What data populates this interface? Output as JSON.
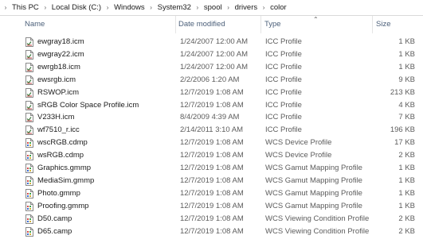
{
  "breadcrumb": [
    "This PC",
    "Local Disk (C:)",
    "Windows",
    "System32",
    "spool",
    "drivers",
    "color"
  ],
  "columns": {
    "name": "Name",
    "date": "Date modified",
    "type": "Type",
    "size": "Size"
  },
  "files": [
    {
      "name": "ewgray18.icm",
      "date": "1/24/2007 12:00 AM",
      "type": "ICC Profile",
      "size": "1 KB",
      "icon": "icc-profile-icon"
    },
    {
      "name": "ewgray22.icm",
      "date": "1/24/2007 12:00 AM",
      "type": "ICC Profile",
      "size": "1 KB",
      "icon": "icc-profile-icon"
    },
    {
      "name": "ewrgb18.icm",
      "date": "1/24/2007 12:00 AM",
      "type": "ICC Profile",
      "size": "1 KB",
      "icon": "icc-profile-icon"
    },
    {
      "name": "ewsrgb.icm",
      "date": "2/2/2006 1:20 AM",
      "type": "ICC Profile",
      "size": "9 KB",
      "icon": "icc-profile-icon"
    },
    {
      "name": "RSWOP.icm",
      "date": "12/7/2019 1:08 AM",
      "type": "ICC Profile",
      "size": "213 KB",
      "icon": "icc-profile-icon"
    },
    {
      "name": "sRGB Color Space Profile.icm",
      "date": "12/7/2019 1:08 AM",
      "type": "ICC Profile",
      "size": "4 KB",
      "icon": "icc-profile-icon"
    },
    {
      "name": "V233H.icm",
      "date": "8/4/2009 4:39 AM",
      "type": "ICC Profile",
      "size": "7 KB",
      "icon": "icc-profile-icon"
    },
    {
      "name": "wf7510_r.icc",
      "date": "2/14/2011 3:10 AM",
      "type": "ICC Profile",
      "size": "196 KB",
      "icon": "icc-profile-icon"
    },
    {
      "name": "wscRGB.cdmp",
      "date": "12/7/2019 1:08 AM",
      "type": "WCS Device Profile",
      "size": "17 KB",
      "icon": "wcs-profile-icon"
    },
    {
      "name": "wsRGB.cdmp",
      "date": "12/7/2019 1:08 AM",
      "type": "WCS Device Profile",
      "size": "2 KB",
      "icon": "wcs-profile-icon"
    },
    {
      "name": "Graphics.gmmp",
      "date": "12/7/2019 1:08 AM",
      "type": "WCS Gamut Mapping Profile",
      "size": "1 KB",
      "icon": "wcs-profile-icon"
    },
    {
      "name": "MediaSim.gmmp",
      "date": "12/7/2019 1:08 AM",
      "type": "WCS Gamut Mapping Profile",
      "size": "1 KB",
      "icon": "wcs-profile-icon"
    },
    {
      "name": "Photo.gmmp",
      "date": "12/7/2019 1:08 AM",
      "type": "WCS Gamut Mapping Profile",
      "size": "1 KB",
      "icon": "wcs-profile-icon"
    },
    {
      "name": "Proofing.gmmp",
      "date": "12/7/2019 1:08 AM",
      "type": "WCS Gamut Mapping Profile",
      "size": "1 KB",
      "icon": "wcs-profile-icon"
    },
    {
      "name": "D50.camp",
      "date": "12/7/2019 1:08 AM",
      "type": "WCS Viewing Condition Profile",
      "size": "2 KB",
      "icon": "wcs-profile-icon"
    },
    {
      "name": "D65.camp",
      "date": "12/7/2019 1:08 AM",
      "type": "WCS Viewing Condition Profile",
      "size": "2 KB",
      "icon": "wcs-profile-icon"
    }
  ],
  "colors": {
    "header_text": "#4c607a",
    "secondary_text": "#5c5c5c",
    "divider": "#e5e5e5"
  }
}
